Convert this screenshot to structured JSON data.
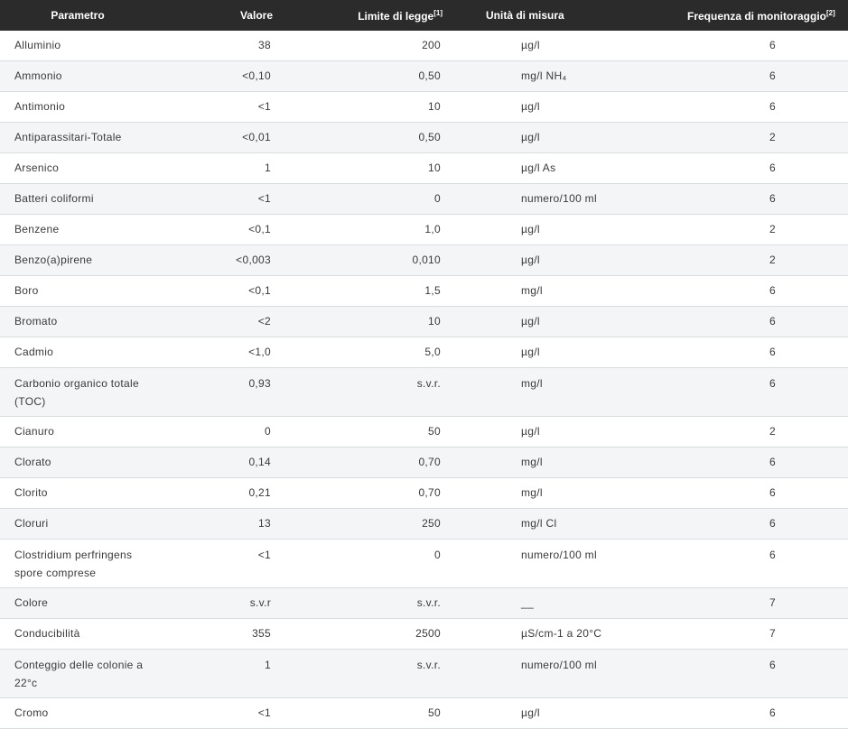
{
  "headers": {
    "parametro": "Parametro",
    "valore": "Valore",
    "limite": "Limite di legge",
    "limite_note": "[1]",
    "unita": "Unità di misura",
    "frequenza": "Frequenza di monitoraggio",
    "frequenza_note": "[2]"
  },
  "rows": [
    {
      "parametro": "Alluminio",
      "valore": "38",
      "limite": "200",
      "unita": "µg/l",
      "frequenza": "6"
    },
    {
      "parametro": "Ammonio",
      "valore": "<0,10",
      "limite": "0,50",
      "unita": "mg/l NH₄",
      "frequenza": "6"
    },
    {
      "parametro": "Antimonio",
      "valore": "<1",
      "limite": "10",
      "unita": "µg/l",
      "frequenza": "6"
    },
    {
      "parametro": "Antiparassitari-Totale",
      "valore": "<0,01",
      "limite": "0,50",
      "unita": "µg/l",
      "frequenza": "2"
    },
    {
      "parametro": "Arsenico",
      "valore": "1",
      "limite": "10",
      "unita": "µg/l As",
      "frequenza": "6"
    },
    {
      "parametro": "Batteri coliformi",
      "valore": "<1",
      "limite": "0",
      "unita": "numero/100 ml",
      "frequenza": "6"
    },
    {
      "parametro": "Benzene",
      "valore": "<0,1",
      "limite": "1,0",
      "unita": "µg/l",
      "frequenza": "2"
    },
    {
      "parametro": "Benzo(a)pirene",
      "valore": "<0,003",
      "limite": "0,010",
      "unita": "µg/l",
      "frequenza": "2"
    },
    {
      "parametro": "Boro",
      "valore": "<0,1",
      "limite": "1,5",
      "unita": "mg/l",
      "frequenza": "6"
    },
    {
      "parametro": "Bromato",
      "valore": "<2",
      "limite": "10",
      "unita": "µg/l",
      "frequenza": "6"
    },
    {
      "parametro": "Cadmio",
      "valore": "<1,0",
      "limite": "5,0",
      "unita": "µg/l",
      "frequenza": "6"
    },
    {
      "parametro": "Carbonio organico totale (TOC)",
      "valore": "0,93",
      "limite": "s.v.r.",
      "unita": "mg/l",
      "frequenza": "6"
    },
    {
      "parametro": "Cianuro",
      "valore": "0",
      "limite": "50",
      "unita": "µg/l",
      "frequenza": "2"
    },
    {
      "parametro": "Clorato",
      "valore": "0,14",
      "limite": "0,70",
      "unita": "mg/l",
      "frequenza": "6"
    },
    {
      "parametro": "Clorito",
      "valore": "0,21",
      "limite": "0,70",
      "unita": "mg/l",
      "frequenza": "6"
    },
    {
      "parametro": "Cloruri",
      "valore": "13",
      "limite": "250",
      "unita": "mg/l Cl",
      "frequenza": "6"
    },
    {
      "parametro": "Clostridium perfringens spore comprese",
      "valore": "<1",
      "limite": "0",
      "unita": "numero/100 ml",
      "frequenza": "6"
    },
    {
      "parametro": "Colore",
      "valore": "s.v.r",
      "limite": "s.v.r.",
      "unita": "__",
      "frequenza": "7"
    },
    {
      "parametro": "Conducibilità",
      "valore": "355",
      "limite": "2500",
      "unita": "µS/cm-1 a 20°C",
      "frequenza": "7"
    },
    {
      "parametro": "Conteggio delle colonie a 22°c",
      "valore": "1",
      "limite": "s.v.r.",
      "unita": "numero/100 ml",
      "frequenza": "6"
    },
    {
      "parametro": "Cromo",
      "valore": "<1",
      "limite": "50",
      "unita": "µg/l",
      "frequenza": "6"
    }
  ],
  "colors": {
    "header_bg": "#2b2b2b",
    "header_text": "#ffffff",
    "row_alt": "#f3f5f7",
    "border": "#d6dde3"
  }
}
